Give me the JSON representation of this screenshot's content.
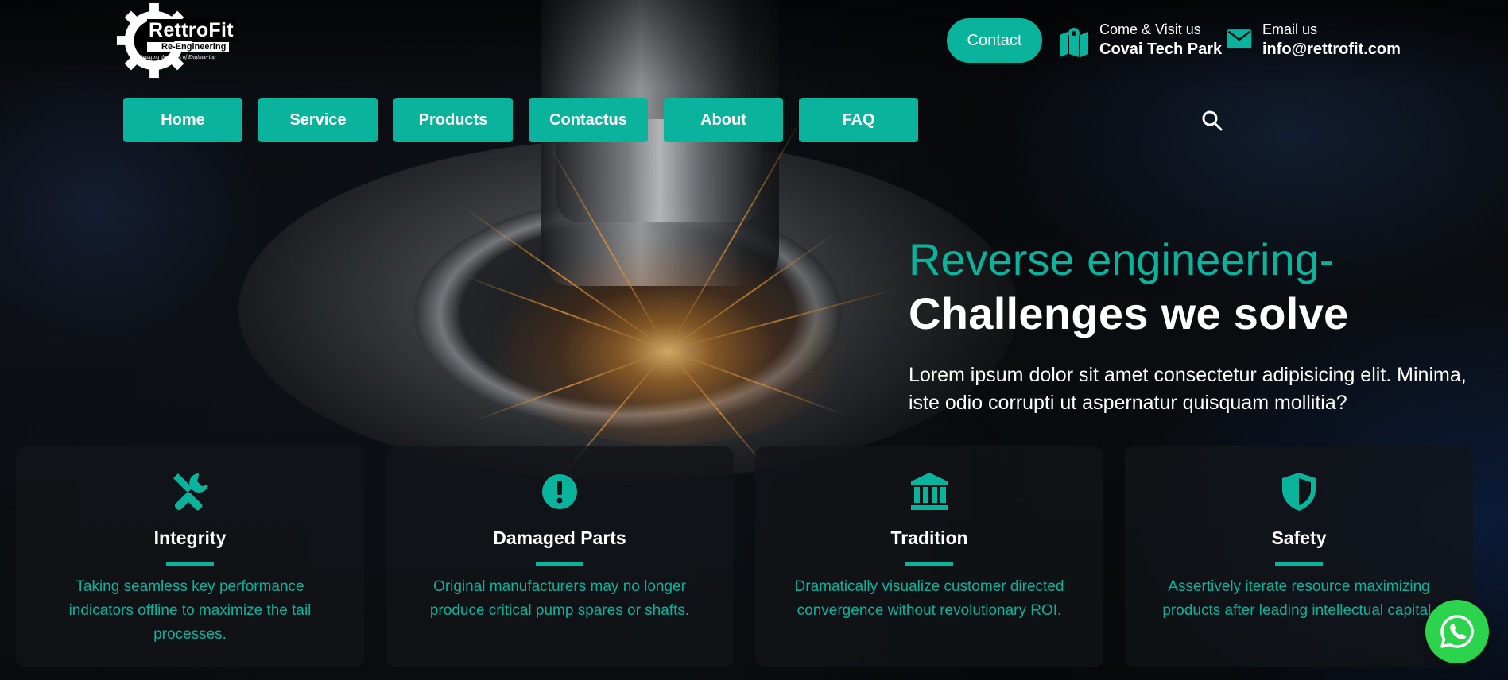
{
  "brand": {
    "name": "RettroFit",
    "subtitle": "Re-Engineering",
    "tagline": "Reimaging the limits of Engineering"
  },
  "header": {
    "contact_button": "Contact",
    "visit": {
      "label": "Come & Visit us",
      "value": "Covai Tech Park",
      "icon": "map-icon"
    },
    "email": {
      "label": "Email us",
      "value": "info@rettrofit.com",
      "icon": "mail-icon"
    }
  },
  "nav": {
    "items": [
      {
        "label": "Home"
      },
      {
        "label": "Service"
      },
      {
        "label": "Products"
      },
      {
        "label": "Contactus"
      },
      {
        "label": "About"
      },
      {
        "label": "FAQ"
      }
    ],
    "search_icon": "search-icon"
  },
  "hero": {
    "heading_accent": "Reverse engineering-",
    "heading_main": "Challenges we solve",
    "body": "Lorem ipsum dolor sit amet consectetur adipisicing elit. Minima, iste odio corrupti ut aspernatur quisquam mollitia?"
  },
  "features": [
    {
      "title": "Integrity",
      "text": "Taking seamless key performance indicators offline to maximize the tail processes.",
      "icon": "tools-icon"
    },
    {
      "title": "Damaged Parts",
      "text": "Original manufacturers may no longer produce critical pump spares or shafts.",
      "icon": "alert-icon"
    },
    {
      "title": "Tradition",
      "text": "Dramatically visualize customer directed convergence without revolutionary ROI.",
      "icon": "bank-icon"
    },
    {
      "title": "Safety",
      "text": "Assertively iterate resource maximizing products after leading intellectual capital.",
      "icon": "shield-icon"
    }
  ],
  "colors": {
    "accent": "#0ab39c",
    "whatsapp": "#2bd44c"
  },
  "floating": {
    "icon": "whatsapp-icon"
  }
}
